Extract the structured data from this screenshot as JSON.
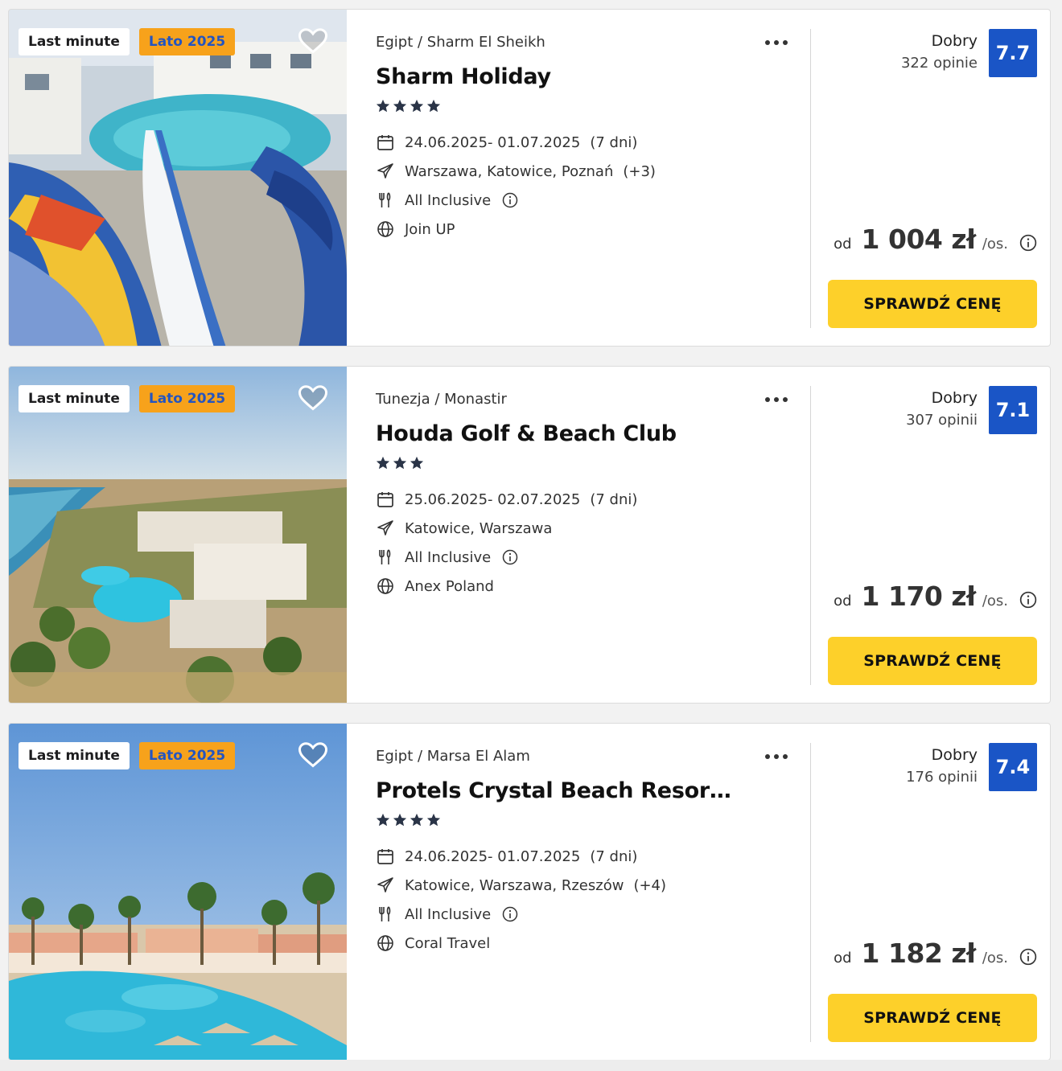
{
  "colors": {
    "accent_blue": "#1a55c6",
    "button_yellow": "#fdd02a",
    "badge_orange": "#f7a21b",
    "badge_text_blue": "#2455c0"
  },
  "offers": [
    {
      "badges": {
        "last_minute": "Last minute",
        "season": "Lato 2025"
      },
      "location": "Egipt / Sharm El Sheikh",
      "name": "Sharm Holiday",
      "stars": 4,
      "dates": "24.06.2025- 01.07.2025",
      "duration": "(7 dni)",
      "departure": "Warszawa, Katowice, Poznań",
      "departure_extra": "(+3)",
      "board": "All Inclusive",
      "operator": "Join UP",
      "rating_word": "Dobry",
      "reviews": "322 opinie",
      "score": "7.7",
      "price_prefix": "od",
      "price": "1 004 zł",
      "price_unit": "/os.",
      "cta": "SPRAWDŹ CENĘ",
      "image": "waterpark-slides"
    },
    {
      "badges": {
        "last_minute": "Last minute",
        "season": "Lato 2025"
      },
      "location": "Tunezja / Monastir",
      "name": "Houda Golf & Beach Club",
      "stars": 3,
      "dates": "25.06.2025- 02.07.2025",
      "duration": "(7 dni)",
      "departure": "Katowice, Warszawa",
      "departure_extra": "",
      "board": "All Inclusive",
      "operator": "Anex Poland",
      "rating_word": "Dobry",
      "reviews": "307 opinii",
      "score": "7.1",
      "price_prefix": "od",
      "price": "1 170 zł",
      "price_unit": "/os.",
      "cta": "SPRAWDŹ CENĘ",
      "image": "aerial-resort-coast"
    },
    {
      "badges": {
        "last_minute": "Last minute",
        "season": "Lato 2025"
      },
      "location": "Egipt / Marsa El Alam",
      "name": "Protels Crystal Beach Resort (e...",
      "stars": 4,
      "dates": "24.06.2025- 01.07.2025",
      "duration": "(7 dni)",
      "departure": "Katowice, Warszawa, Rzeszów",
      "departure_extra": "(+4)",
      "board": "All Inclusive",
      "operator": "Coral Travel",
      "rating_word": "Dobry",
      "reviews": "176 opinii",
      "score": "7.4",
      "price_prefix": "od",
      "price": "1 182 zł",
      "price_unit": "/os.",
      "cta": "SPRAWDŹ CENĘ",
      "image": "pool-palms-resort"
    }
  ]
}
